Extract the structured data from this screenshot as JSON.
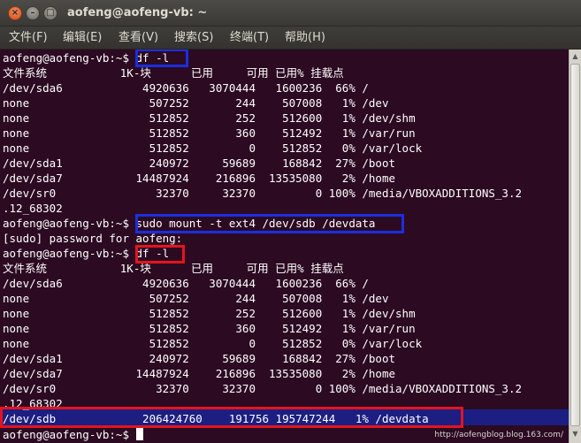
{
  "window": {
    "title": "aofeng@aofeng-vb: ~"
  },
  "menu": [
    "文件(F)",
    "编辑(E)",
    "查看(V)",
    "搜索(S)",
    "终端(T)",
    "帮助(H)"
  ],
  "terminal_lines": [
    "aofeng@aofeng-vb:~$ df -l",
    "文件系统           1K-块      已用     可用 已用% 挂载点",
    "/dev/sda6            4920636   3070444   1600236  66% /",
    "none                  507252       244    507008   1% /dev",
    "none                  512852       252    512600   1% /dev/shm",
    "none                  512852       360    512492   1% /var/run",
    "none                  512852         0    512852   0% /var/lock",
    "/dev/sda1             240972     59689    168842  27% /boot",
    "/dev/sda7           14487924    216896  13535080   2% /home",
    "/dev/sr0               32370     32370         0 100% /media/VBOXADDITIONS_3.2",
    ".12_68302",
    "aofeng@aofeng-vb:~$ sudo mount -t ext4 /dev/sdb /devdata",
    "[sudo] password for aofeng:",
    "aofeng@aofeng-vb:~$ df -l",
    "文件系统           1K-块      已用     可用 已用% 挂载点",
    "/dev/sda6            4920636   3070444   1600236  66% /",
    "none                  507252       244    507008   1% /dev",
    "none                  512852       252    512600   1% /dev/shm",
    "none                  512852       360    512492   1% /var/run",
    "none                  512852         0    512852   0% /var/lock",
    "/dev/sda1             240972     59689    168842  27% /boot",
    "/dev/sda7           14487924    216896  13535080   2% /home",
    "/dev/sr0               32370     32370         0 100% /media/VBOXADDITIONS_3.2",
    ".12_68302",
    "/dev/sdb             206424760    191756 195747244   1% /devdata",
    "aofeng@aofeng-vb:~$ "
  ],
  "watermark": "http://aofengblog.blog.163.com/",
  "colors": {
    "terminal_bg": "#2c0a22",
    "highlight_blue": "#1c2ee0",
    "highlight_red": "#e4141e",
    "selection_bg": "#1c1e82"
  }
}
